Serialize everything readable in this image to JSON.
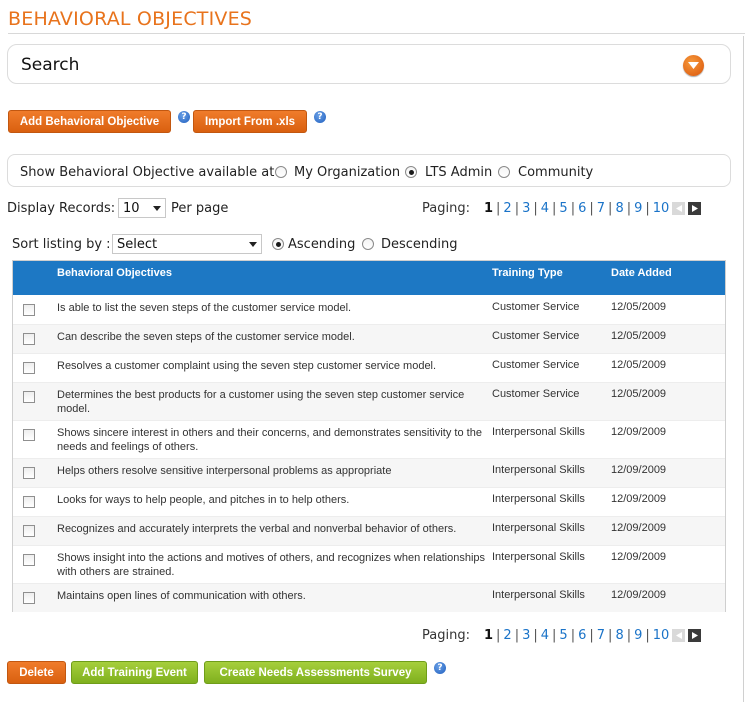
{
  "page": {
    "title": "BEHAVIORAL OBJECTIVES"
  },
  "search": {
    "label": "Search",
    "toggle_icon": "chevron-down-icon"
  },
  "top_actions": {
    "add_label": "Add Behavioral Objective",
    "import_label": "Import From .xls",
    "help_glyph": "?"
  },
  "availability": {
    "label": "Show Behavioral Objective available at",
    "options": [
      {
        "label": "My Organization",
        "selected": false
      },
      {
        "label": "LTS Admin",
        "selected": true
      },
      {
        "label": "Community",
        "selected": false
      }
    ]
  },
  "display": {
    "label": "Display Records:",
    "value": "10",
    "suffix": "Per page"
  },
  "paging": {
    "label": "Paging:",
    "pages": [
      "1",
      "2",
      "3",
      "4",
      "5",
      "6",
      "7",
      "8",
      "9",
      "10"
    ],
    "current": "1"
  },
  "sort": {
    "label": "Sort listing by :",
    "value": "Select",
    "ascending_label": "Ascending",
    "descending_label": "Descending",
    "ascending_selected": true
  },
  "table": {
    "columns": [
      "Behavioral Objectives",
      "Training Type",
      "Date Added"
    ],
    "rows": [
      {
        "objective": "Is able to list the seven steps of the customer service model.",
        "type": "Customer Service",
        "date": "12/05/2009"
      },
      {
        "objective": "Can describe the seven steps of the customer service model.",
        "type": "Customer Service",
        "date": "12/05/2009"
      },
      {
        "objective": "Resolves a customer complaint using the seven step customer service model.",
        "type": "Customer Service",
        "date": "12/05/2009"
      },
      {
        "objective": "Determines the best products for a customer using the seven step customer service model.",
        "type": "Customer Service",
        "date": "12/05/2009"
      },
      {
        "objective": "Shows sincere interest in others and their concerns, and demonstrates sensitivity to the needs and feelings of others.",
        "type": "Interpersonal Skills",
        "date": "12/09/2009"
      },
      {
        "objective": "Helps others resolve sensitive interpersonal problems as appropriate",
        "type": "Interpersonal Skills",
        "date": "12/09/2009"
      },
      {
        "objective": "Looks for ways to help people, and pitches in to help others.",
        "type": "Interpersonal Skills",
        "date": "12/09/2009"
      },
      {
        "objective": "Recognizes and accurately interprets the verbal and nonverbal behavior of others.",
        "type": "Interpersonal Skills",
        "date": "12/09/2009"
      },
      {
        "objective": "Shows insight into the actions and motives of others, and recognizes when relationships with others are strained.",
        "type": "Interpersonal Skills",
        "date": "12/09/2009"
      },
      {
        "objective": "Maintains open lines of communication with others.",
        "type": "Interpersonal Skills",
        "date": "12/09/2009"
      }
    ]
  },
  "bottom_actions": {
    "delete_label": "Delete",
    "add_training_label": "Add Training Event",
    "survey_label": "Create Needs Assessments Survey"
  },
  "colors": {
    "accent_orange": "#e8731c",
    "header_blue": "#1d78c4",
    "action_green": "#8cbd2a",
    "link_blue": "#1a73c8"
  }
}
